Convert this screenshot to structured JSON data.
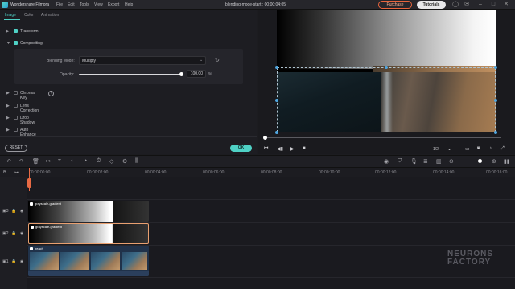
{
  "titlebar": {
    "app_name": "Wondershare Filmora",
    "menu": [
      "File",
      "Edit",
      "Tools",
      "View",
      "Export",
      "Help"
    ],
    "document_title": "blending-mode-start : 00:00:04:05",
    "purchase_label": "Purchase",
    "tutorials_label": "Tutorials"
  },
  "panel": {
    "tabs": [
      "Image",
      "Color",
      "Animation"
    ],
    "active_tab": "Image",
    "sections": {
      "transform": "Transform",
      "compositing": "Compositing",
      "chroma_key": "Chroma Key",
      "lens_correction": "Lens Correction",
      "drop_shadow": "Drop Shadow",
      "auto_enhance": "Auto Enhance"
    },
    "blend_mode_label": "Blending Mode:",
    "blend_mode_value": "Multiply",
    "opacity_label": "Opacity:",
    "opacity_value": "100.00",
    "opacity_unit": "%",
    "opacity_fraction": 1.0,
    "reset_label": "RESET",
    "ok_label": "OK"
  },
  "preview": {
    "ratio": "1/2"
  },
  "timeline": {
    "timecodes": [
      "00:00:00:00",
      "00:00:02:00",
      "00:00:04:00",
      "00:00:06:00",
      "00:00:08:00",
      "00:00:10:00",
      "00:00:12:00",
      "00:00:14:00",
      "00:00:16:00"
    ],
    "clips": {
      "gradient_1": "grayscale-gradient",
      "gradient_2": "grayscale-gradient",
      "beach": "beach"
    }
  },
  "watermark": {
    "line1": "NEURONS",
    "line2": "FACTORY"
  },
  "colors": {
    "accent": "#4fd1c5",
    "purchase": "#e8643c",
    "playhead": "#e86a44"
  }
}
